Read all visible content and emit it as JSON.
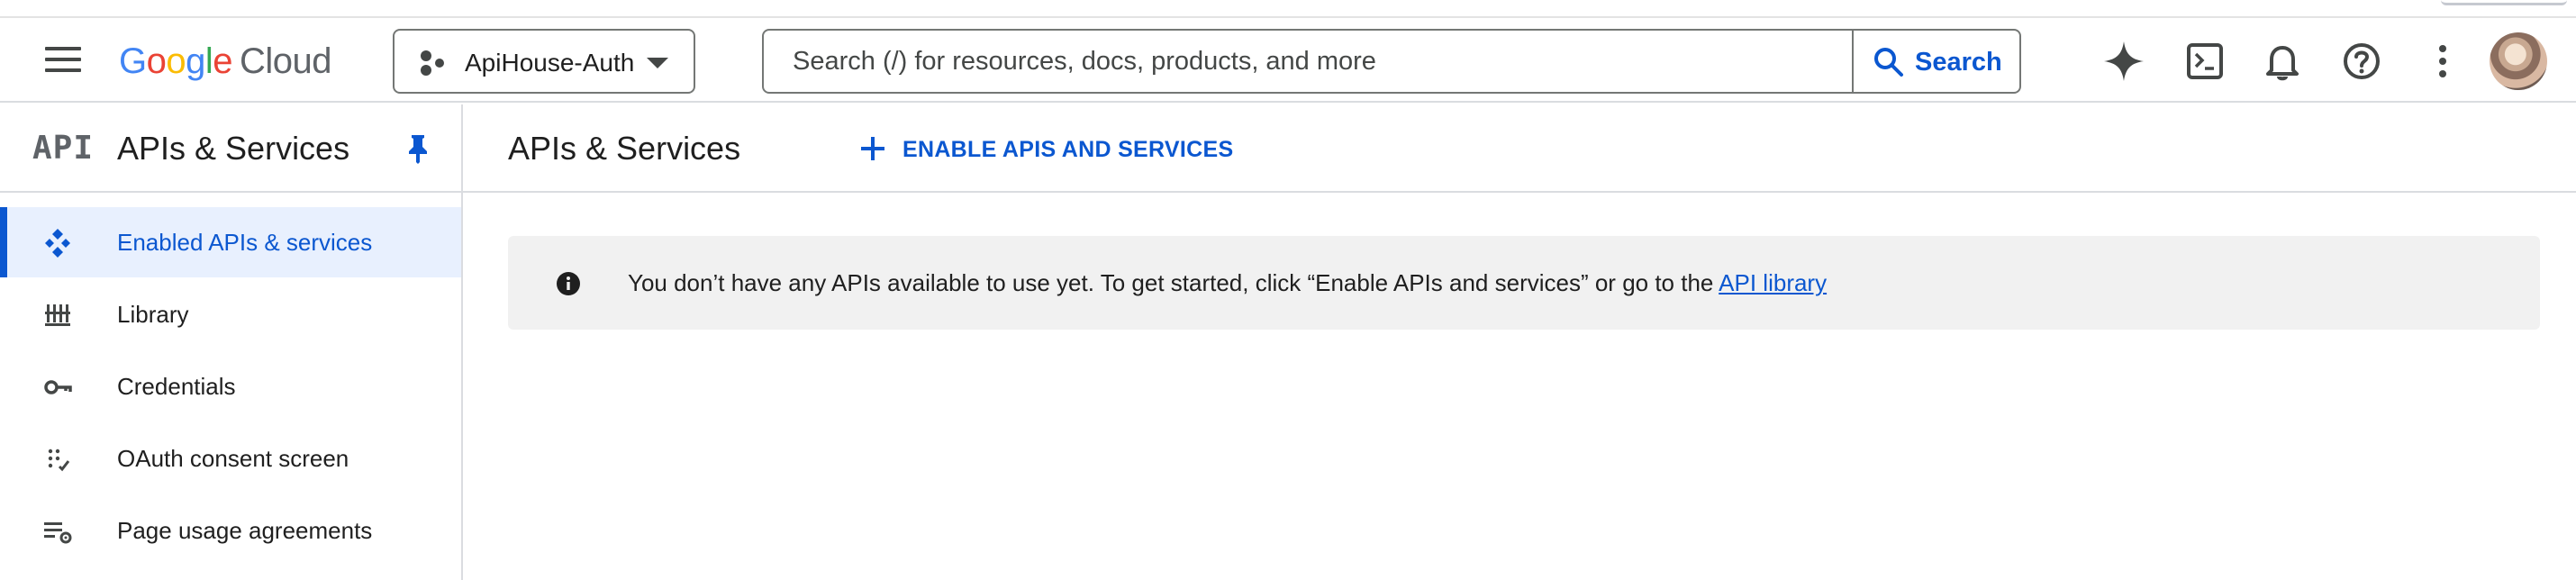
{
  "header": {
    "logo": {
      "letters": [
        "G",
        "o",
        "o",
        "g",
        "l",
        "e"
      ],
      "product": "Cloud"
    },
    "project_picker": {
      "label": "ApiHouse-Auth"
    },
    "search": {
      "placeholder": "Search (/) for resources, docs, products, and more",
      "button_label": "Search"
    },
    "icons": [
      "gemini-sparkle-icon",
      "cloud-shell-icon",
      "notifications-bell-icon",
      "help-icon",
      "more-vert-icon",
      "avatar"
    ]
  },
  "sidebar": {
    "logo_text": "API",
    "title": "APIs & Services",
    "items": [
      {
        "label": "Enabled APIs & services",
        "icon": "enabled-apis-icon",
        "active": true
      },
      {
        "label": "Library",
        "icon": "library-icon",
        "active": false
      },
      {
        "label": "Credentials",
        "icon": "key-icon",
        "active": false
      },
      {
        "label": "OAuth consent screen",
        "icon": "oauth-icon",
        "active": false
      },
      {
        "label": "Page usage agreements",
        "icon": "settings-list-icon",
        "active": false
      }
    ]
  },
  "main": {
    "title": "APIs & Services",
    "enable_button_label": "ENABLE APIS AND SERVICES",
    "info_banner": {
      "text": "You don’t have any APIs available to use yet. To get started, click “Enable APIs and services” or go to the ",
      "link_text": "API library"
    }
  },
  "colors": {
    "accent": "#0b57d0",
    "active_nav_bg": "#e8f0fe",
    "banner_bg": "#f1f1f1",
    "divider": "#dadce0"
  }
}
